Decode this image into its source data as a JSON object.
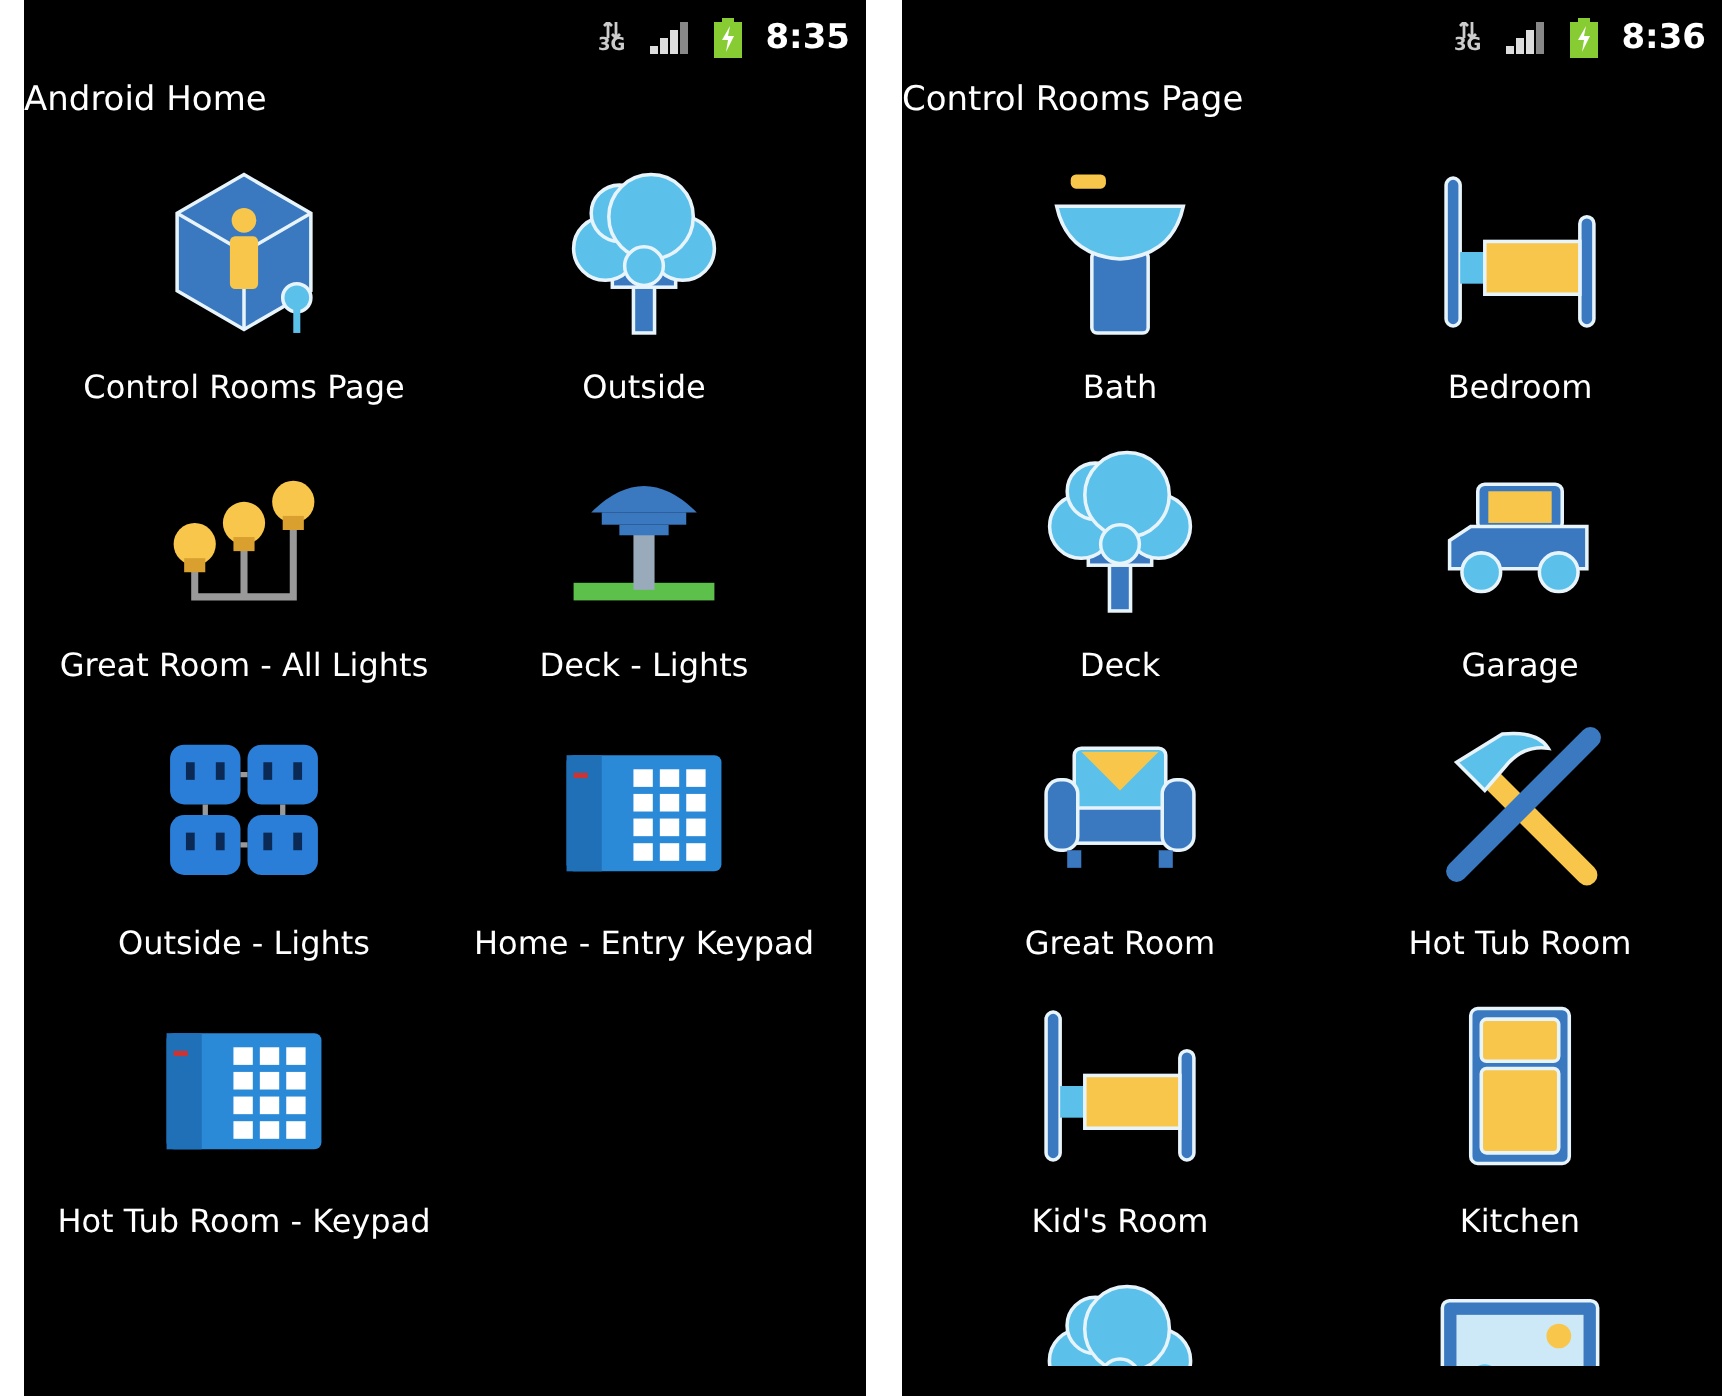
{
  "screens": [
    {
      "status_bar": {
        "network": "3G",
        "time": "8:35"
      },
      "title": "Android Home",
      "items": [
        {
          "label": "Control Rooms Page",
          "kind": "rooms"
        },
        {
          "label": "Outside",
          "kind": "tree"
        },
        {
          "label": "Great Room - All Lights",
          "kind": "bulbs"
        },
        {
          "label": "Deck - Lights",
          "kind": "lamp"
        },
        {
          "label": "Outside - Lights",
          "kind": "outlets"
        },
        {
          "label": "Home - Entry Keypad",
          "kind": "keypad"
        },
        {
          "label": "Hot Tub Room - Keypad",
          "kind": "keypad"
        }
      ]
    },
    {
      "status_bar": {
        "network": "3G",
        "time": "8:36"
      },
      "title": "Control Rooms Page",
      "items": [
        {
          "label": "Bath",
          "kind": "sink"
        },
        {
          "label": "Bedroom",
          "kind": "bed"
        },
        {
          "label": "Deck",
          "kind": "tree"
        },
        {
          "label": "Garage",
          "kind": "car"
        },
        {
          "label": "Great Room",
          "kind": "chair"
        },
        {
          "label": "Hot Tub Room",
          "kind": "tools"
        },
        {
          "label": "Kid's Room",
          "kind": "bed"
        },
        {
          "label": "Kitchen",
          "kind": "fridge"
        },
        {
          "kind": "tree"
        },
        {
          "kind": "picture"
        }
      ]
    }
  ]
}
